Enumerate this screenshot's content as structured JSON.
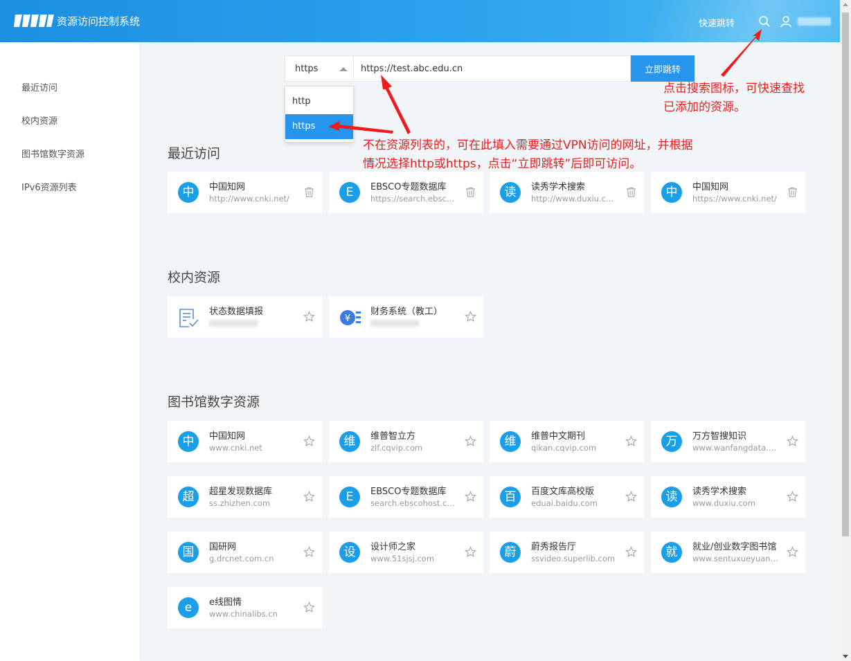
{
  "header": {
    "app_title": "资源访问控制系统",
    "quick_jump": "快速跳转"
  },
  "sidebar": {
    "items": [
      {
        "label": "最近访问"
      },
      {
        "label": "校内资源"
      },
      {
        "label": "图书馆数字资源"
      },
      {
        "label": "IPv6资源列表"
      }
    ]
  },
  "jump_bar": {
    "protocol_selected": "https",
    "protocol_options": [
      "http",
      "https"
    ],
    "url_value": "https://test.abc.edu.cn",
    "go_label": "立即跳转"
  },
  "sections": {
    "recent": {
      "title": "最近访问",
      "items": [
        {
          "icon_char": "中",
          "name": "中国知网",
          "url": "http://www.cnki.net/"
        },
        {
          "icon_char": "E",
          "name": "EBSCO专题数据库",
          "url": "https://search.ebscohost.com"
        },
        {
          "icon_char": "读",
          "name": "读秀学术搜索",
          "url": "http://www.duxiu.com/"
        },
        {
          "icon_char": "中",
          "name": "中国知网",
          "url": "https://www.cnki.net/"
        }
      ]
    },
    "campus": {
      "title": "校内资源",
      "items": [
        {
          "icon": "form-check-icon",
          "name": "状态数据填报"
        },
        {
          "icon": "finance-yuan-icon",
          "name": "财务系统（教工）"
        }
      ]
    },
    "library": {
      "title": "图书馆数字资源",
      "items": [
        {
          "icon_char": "中",
          "name": "中国知网",
          "url": "www.cnki.net"
        },
        {
          "icon_char": "维",
          "name": "维普智立方",
          "url": "zlf.cqvip.com"
        },
        {
          "icon_char": "维",
          "name": "维普中文期刊",
          "url": "qikan.cqvip.com"
        },
        {
          "icon_char": "万",
          "name": "万方智搜知识",
          "url": "www.wanfangdata.com.cn"
        },
        {
          "icon_char": "超",
          "name": "超星发现数据库",
          "url": "ss.zhizhen.com"
        },
        {
          "icon_char": "E",
          "name": "EBSCO专题数据库",
          "url": "search.ebscohost.com"
        },
        {
          "icon_char": "百",
          "name": "百度文库高校版",
          "url": "eduai.baidu.com"
        },
        {
          "icon_char": "读",
          "name": "读秀学术搜索",
          "url": "www.duxiu.com"
        },
        {
          "icon_char": "国",
          "name": "国研网",
          "url": "g.drcnet.com.cn"
        },
        {
          "icon_char": "设",
          "name": "设计师之家",
          "url": "www.51sjsj.com"
        },
        {
          "icon_char": "蔚",
          "name": "蔚秀报告厅",
          "url": "ssvideo.superlib.com"
        },
        {
          "icon_char": "就",
          "name": "就业/创业数字图书馆",
          "url": "www.sentuxueyuan.com"
        },
        {
          "icon_char": "e",
          "name": "e线图情",
          "url": "www.chinalibs.cn"
        }
      ]
    }
  },
  "annotations": {
    "search_note_line1": "点击搜索图标，可快速查找",
    "search_note_line2": "已添加的资源。",
    "url_note_line1": "不在资源列表的，可在此填入需要通过VPN访问的网址，并根据",
    "url_note_line2": "情况选择http或https，点击“立即跳转”后即可访问。"
  },
  "colors": {
    "accent": "#2595ee",
    "icon_bg": "#1b9ee8",
    "annotation": "#ee1c1c"
  }
}
